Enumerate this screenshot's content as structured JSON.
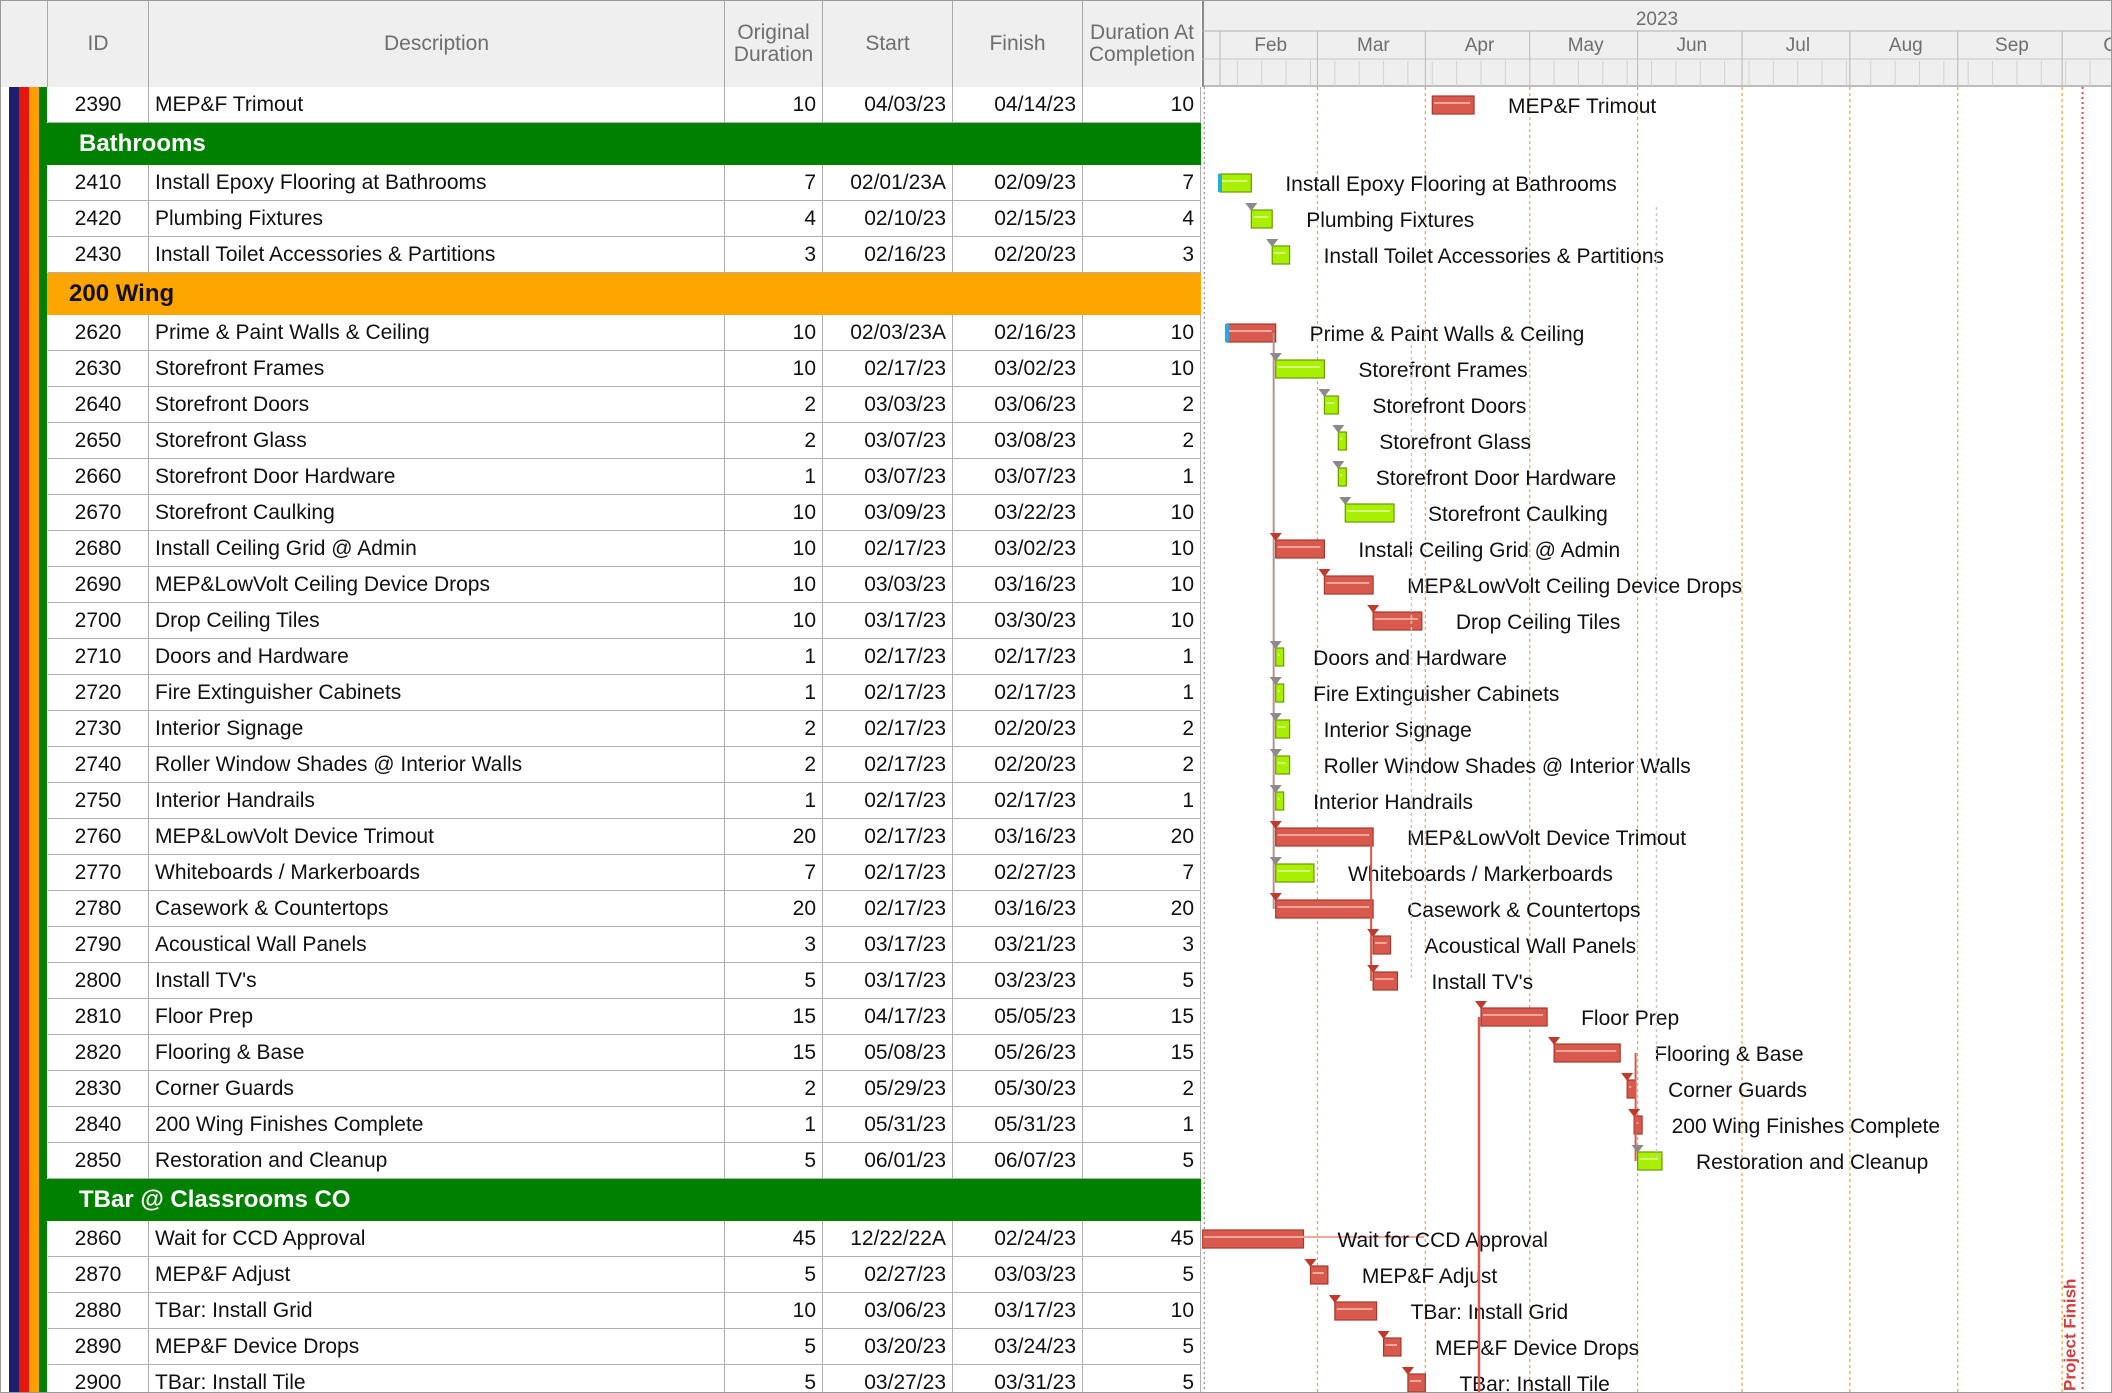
{
  "columns": {
    "id": "ID",
    "description": "Description",
    "original_duration": "Original Duration",
    "start": "Start",
    "finish": "Finish",
    "duration_at_completion": "Duration At Completion"
  },
  "timeline": {
    "year": "2023",
    "months": [
      "Feb",
      "Mar",
      "Apr",
      "May",
      "Jun",
      "Jul",
      "Aug",
      "Sep",
      "Oct"
    ],
    "project_finish_label": "Project Finish"
  },
  "colors": {
    "header_bg": "#efefef",
    "group_green": "#008000",
    "group_orange": "#ffa500",
    "bar_critical": "#d9594c",
    "bar_normal": "#a8f000",
    "actual_blue": "#2aa8e0",
    "band_navy": "#1c1e6e",
    "band_red": "#e8140e",
    "band_orange": "#ffa000",
    "band_green": "#008000"
  },
  "rows": [
    {
      "type": "activity",
      "id": "2390",
      "desc": "MEP&F Trimout",
      "od": "10",
      "start": "04/03/23",
      "finish": "04/14/23",
      "dac": "10",
      "s": 61,
      "f": 72,
      "crit": true
    },
    {
      "type": "group",
      "label": "Bathrooms",
      "color": "green"
    },
    {
      "type": "activity",
      "id": "2410",
      "desc": "Install Epoxy Flooring at Bathrooms",
      "od": "7",
      "start": "02/01/23A",
      "finish": "02/09/23",
      "dac": "7",
      "s": 0,
      "f": 8,
      "crit": false,
      "actual": true
    },
    {
      "type": "activity",
      "id": "2420",
      "desc": "Plumbing Fixtures",
      "od": "4",
      "start": "02/10/23",
      "finish": "02/15/23",
      "dac": "4",
      "s": 9,
      "f": 14,
      "crit": false
    },
    {
      "type": "activity",
      "id": "2430",
      "desc": "Install Toilet Accessories & Partitions",
      "od": "3",
      "start": "02/16/23",
      "finish": "02/20/23",
      "dac": "3",
      "s": 15,
      "f": 19,
      "crit": false
    },
    {
      "type": "group",
      "label": "200 Wing",
      "color": "orange"
    },
    {
      "type": "activity",
      "id": "2620",
      "desc": "Prime & Paint Walls & Ceiling",
      "od": "10",
      "start": "02/03/23A",
      "finish": "02/16/23",
      "dac": "10",
      "s": 2,
      "f": 15,
      "crit": true,
      "actual": true
    },
    {
      "type": "activity",
      "id": "2630",
      "desc": "Storefront Frames",
      "od": "10",
      "start": "02/17/23",
      "finish": "03/02/23",
      "dac": "10",
      "s": 16,
      "f": 29,
      "crit": false
    },
    {
      "type": "activity",
      "id": "2640",
      "desc": "Storefront Doors",
      "od": "2",
      "start": "03/03/23",
      "finish": "03/06/23",
      "dac": "2",
      "s": 30,
      "f": 33,
      "crit": false
    },
    {
      "type": "activity",
      "id": "2650",
      "desc": "Storefront Glass",
      "od": "2",
      "start": "03/07/23",
      "finish": "03/08/23",
      "dac": "2",
      "s": 34,
      "f": 35,
      "crit": false
    },
    {
      "type": "activity",
      "id": "2660",
      "desc": "Storefront Door Hardware",
      "od": "1",
      "start": "03/07/23",
      "finish": "03/07/23",
      "dac": "1",
      "s": 34,
      "f": 34,
      "crit": false
    },
    {
      "type": "activity",
      "id": "2670",
      "desc": "Storefront Caulking",
      "od": "10",
      "start": "03/09/23",
      "finish": "03/22/23",
      "dac": "10",
      "s": 36,
      "f": 49,
      "crit": false
    },
    {
      "type": "activity",
      "id": "2680",
      "desc": "Install Ceiling Grid @ Admin",
      "od": "10",
      "start": "02/17/23",
      "finish": "03/02/23",
      "dac": "10",
      "s": 16,
      "f": 29,
      "crit": true
    },
    {
      "type": "activity",
      "id": "2690",
      "desc": "MEP&LowVolt Ceiling Device Drops",
      "od": "10",
      "start": "03/03/23",
      "finish": "03/16/23",
      "dac": "10",
      "s": 30,
      "f": 43,
      "crit": true
    },
    {
      "type": "activity",
      "id": "2700",
      "desc": "Drop Ceiling Tiles",
      "od": "10",
      "start": "03/17/23",
      "finish": "03/30/23",
      "dac": "10",
      "s": 44,
      "f": 57,
      "crit": true
    },
    {
      "type": "activity",
      "id": "2710",
      "desc": "Doors and Hardware",
      "od": "1",
      "start": "02/17/23",
      "finish": "02/17/23",
      "dac": "1",
      "s": 16,
      "f": 16,
      "crit": false
    },
    {
      "type": "activity",
      "id": "2720",
      "desc": "Fire Extinguisher Cabinets",
      "od": "1",
      "start": "02/17/23",
      "finish": "02/17/23",
      "dac": "1",
      "s": 16,
      "f": 16,
      "crit": false
    },
    {
      "type": "activity",
      "id": "2730",
      "desc": "Interior Signage",
      "od": "2",
      "start": "02/17/23",
      "finish": "02/20/23",
      "dac": "2",
      "s": 16,
      "f": 19,
      "crit": false
    },
    {
      "type": "activity",
      "id": "2740",
      "desc": "Roller Window Shades @ Interior Walls",
      "od": "2",
      "start": "02/17/23",
      "finish": "02/20/23",
      "dac": "2",
      "s": 16,
      "f": 19,
      "crit": false
    },
    {
      "type": "activity",
      "id": "2750",
      "desc": "Interior Handrails",
      "od": "1",
      "start": "02/17/23",
      "finish": "02/17/23",
      "dac": "1",
      "s": 16,
      "f": 16,
      "crit": false
    },
    {
      "type": "activity",
      "id": "2760",
      "desc": "MEP&LowVolt Device Trimout",
      "od": "20",
      "start": "02/17/23",
      "finish": "03/16/23",
      "dac": "20",
      "s": 16,
      "f": 43,
      "crit": true
    },
    {
      "type": "activity",
      "id": "2770",
      "desc": "Whiteboards / Markerboards",
      "od": "7",
      "start": "02/17/23",
      "finish": "02/27/23",
      "dac": "7",
      "s": 16,
      "f": 26,
      "crit": false
    },
    {
      "type": "activity",
      "id": "2780",
      "desc": "Casework & Countertops",
      "od": "20",
      "start": "02/17/23",
      "finish": "03/16/23",
      "dac": "20",
      "s": 16,
      "f": 43,
      "crit": true
    },
    {
      "type": "activity",
      "id": "2790",
      "desc": "Acoustical Wall Panels",
      "od": "3",
      "start": "03/17/23",
      "finish": "03/21/23",
      "dac": "3",
      "s": 44,
      "f": 48,
      "crit": true
    },
    {
      "type": "activity",
      "id": "2800",
      "desc": "Install TV's",
      "od": "5",
      "start": "03/17/23",
      "finish": "03/23/23",
      "dac": "5",
      "s": 44,
      "f": 50,
      "crit": true
    },
    {
      "type": "activity",
      "id": "2810",
      "desc": "Floor Prep",
      "od": "15",
      "start": "04/17/23",
      "finish": "05/05/23",
      "dac": "15",
      "s": 75,
      "f": 93,
      "crit": true
    },
    {
      "type": "activity",
      "id": "2820",
      "desc": "Flooring & Base",
      "od": "15",
      "start": "05/08/23",
      "finish": "05/26/23",
      "dac": "15",
      "s": 96,
      "f": 114,
      "crit": true
    },
    {
      "type": "activity",
      "id": "2830",
      "desc": "Corner Guards",
      "od": "2",
      "start": "05/29/23",
      "finish": "05/30/23",
      "dac": "2",
      "s": 117,
      "f": 118,
      "crit": true
    },
    {
      "type": "activity",
      "id": "2840",
      "desc": "200 Wing Finishes Complete",
      "od": "1",
      "start": "05/31/23",
      "finish": "05/31/23",
      "dac": "1",
      "s": 119,
      "f": 119,
      "crit": true
    },
    {
      "type": "activity",
      "id": "2850",
      "desc": "Restoration and Cleanup",
      "od": "5",
      "start": "06/01/23",
      "finish": "06/07/23",
      "dac": "5",
      "s": 120,
      "f": 126,
      "crit": false
    },
    {
      "type": "group",
      "label": "TBar @ Classrooms CO",
      "color": "green"
    },
    {
      "type": "activity",
      "id": "2860",
      "desc": "Wait for CCD Approval",
      "od": "45",
      "start": "12/22/22A",
      "finish": "02/24/23",
      "dac": "45",
      "s": -41,
      "f": 23,
      "crit": true
    },
    {
      "type": "activity",
      "id": "2870",
      "desc": "MEP&F Adjust",
      "od": "5",
      "start": "02/27/23",
      "finish": "03/03/23",
      "dac": "5",
      "s": 26,
      "f": 30,
      "crit": true
    },
    {
      "type": "activity",
      "id": "2880",
      "desc": "TBar: Install Grid",
      "od": "10",
      "start": "03/06/23",
      "finish": "03/17/23",
      "dac": "10",
      "s": 33,
      "f": 44,
      "crit": true
    },
    {
      "type": "activity",
      "id": "2890",
      "desc": "MEP&F Device Drops",
      "od": "5",
      "start": "03/20/23",
      "finish": "03/24/23",
      "dac": "5",
      "s": 47,
      "f": 51,
      "crit": true
    },
    {
      "type": "activity",
      "id": "2900",
      "desc": "TBar: Install Tile",
      "od": "5",
      "start": "03/27/23",
      "finish": "03/31/23",
      "dac": "5",
      "s": 54,
      "f": 58,
      "crit": true
    }
  ]
}
